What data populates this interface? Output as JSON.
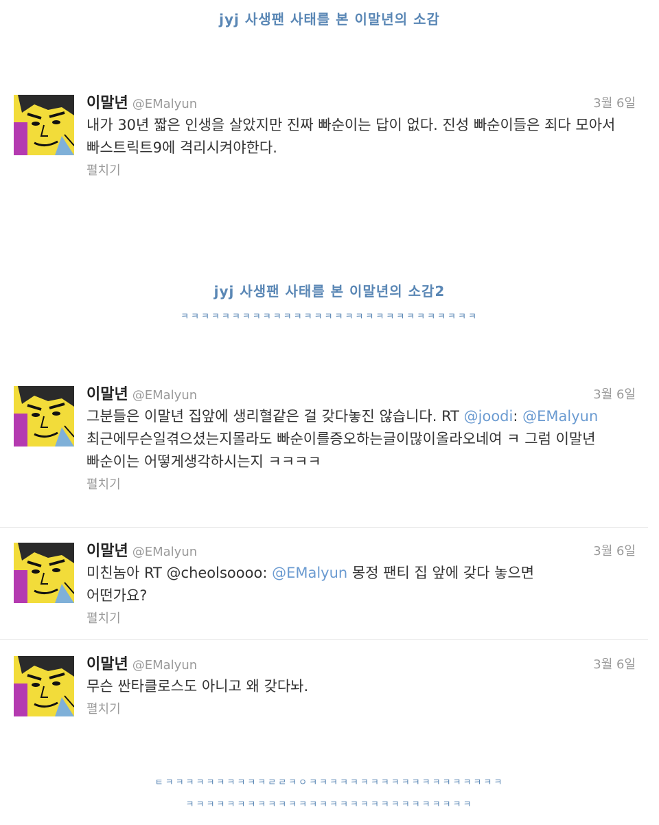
{
  "headline1": "jyj 사생팬 사태를 본 이말년의 소감",
  "headline2": "jyj 사생팬 사태를 본 이말년의 소감2",
  "laugh1": "ㅋㅋㅋㅋㅋㅋㅋㅋㅋㅋㅋㅋㅋㅋㅋㅋㅋㅋㅋㅋㅋㅋㅋㅋㅋㅋㅋㅋㅋ",
  "laugh2": "ㅌㅋㅋㅋㅋㅋㅋㅋㅋㅋㅋㄹㄹㅋㅇㅋㅋㅋㅋㅋㅋㅋㅋㅋㅋㅋㅋㅋㅋㅋㅋㅋㅋㅋ",
  "laugh3": "ㅋㅋㅋㅋㅋㅋㅋㅋㅋㅋㅋㅋㅋㅋㅋㅋㅋㅋㅋㅋㅋㅋㅋㅋㅋㅋㅋㅋ",
  "accent_color": "#5a87b5",
  "mention_color": "#6b9bd1",
  "avatar_icon": "cartoon-face-avatar",
  "tweets": [
    {
      "name": "이말년",
      "handle": "@EMalyun",
      "date": "3월 6일",
      "text": "내가 30년 짧은 인생을 살았지만 진짜 빠순이는 답이 없다. 진성 빠순이들은 죄다 모아서 빠스트릭트9에 격리시켜야한다.",
      "expand": "펼치기"
    },
    {
      "name": "이말년",
      "handle": "@EMalyun",
      "date": "3월 6일",
      "text_pre": "그분들은 이말년 집앞에 생리혈같은 걸 갖다놓진 않습니다. RT ",
      "mention1": "@joodi",
      "colon": ": ",
      "mention2": "@EMalyun",
      "text_post": " 최근에무슨일겪으셨는지몰라도 빠순이를증오하는글이많이올라오네여 ㅋ 그럼 이말년 빠순이는 어떻게생각하시는지 ㅋㅋㅋㅋ",
      "expand": "펼치기"
    },
    {
      "name": "이말년",
      "handle": "@EMalyun",
      "date": "3월 6일",
      "text_pre": "미친놈아 RT @cheolsoooo: ",
      "mention1": "@EMalyun",
      "text_post": " 몽정 팬티 집 앞에 갖다 놓으면 어떤가요?",
      "expand": "펼치기"
    },
    {
      "name": "이말년",
      "handle": "@EMalyun",
      "date": "3월 6일",
      "text": "무슨 싼타클로스도 아니고 왜 갖다놔.",
      "expand": "펼치기"
    }
  ]
}
